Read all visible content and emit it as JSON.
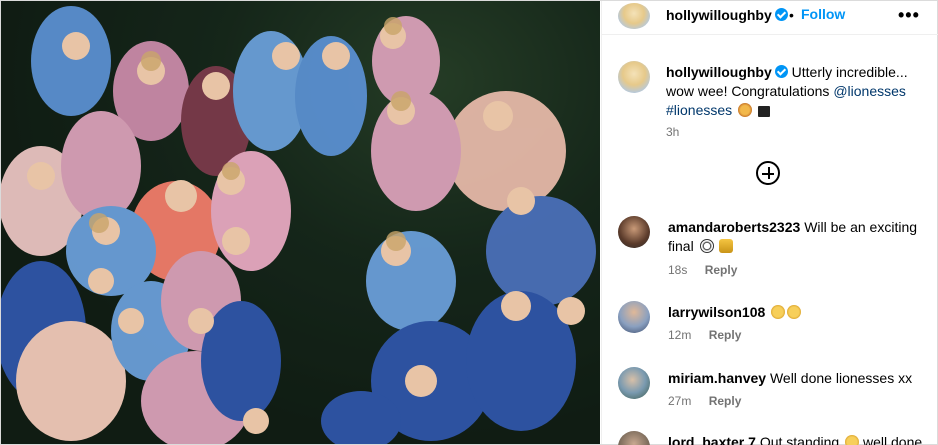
{
  "post": {
    "author": "hollywilloughby",
    "follow_label": "Follow",
    "separator": "•",
    "more_label": "•••",
    "caption": {
      "text": "Utterly incredible... wow wee! Congratulations ",
      "mention": "@lioness",
      "mention_suffix": "es",
      "hashtag": "#lionesses",
      "time": "3h"
    }
  },
  "comments": [
    {
      "username": "amandaroberts2323",
      "text": "Will be an exciting final",
      "emojis": [
        "soccer-ball",
        "trophy"
      ],
      "time": "18s",
      "reply_label": "Reply"
    },
    {
      "username": "larrywilson108",
      "text": "",
      "emojis": [
        "clapping-hands",
        "clapping-hands"
      ],
      "time": "12m",
      "reply_label": "Reply"
    },
    {
      "username": "miriam.hanvey",
      "text": "Well done lionesses xx",
      "emojis": [],
      "time": "27m",
      "reply_label": "Reply"
    },
    {
      "username": "lord_baxter 7",
      "text": "Out standing",
      "trailing_text": "well done",
      "emojis": [
        "clapping-hands"
      ],
      "time": "",
      "reply_label": ""
    }
  ],
  "colors": {
    "link_blue": "#0095f6",
    "tag_blue": "#00376b",
    "muted": "#737373",
    "kit_blue": "#6a9ed8",
    "kit_pink": "#d9a0b8"
  },
  "icons": [
    "verified-badge-icon",
    "more-options-icon",
    "add-comment-icon",
    "lion-emoji-icon",
    "flag-emoji-icon"
  ]
}
